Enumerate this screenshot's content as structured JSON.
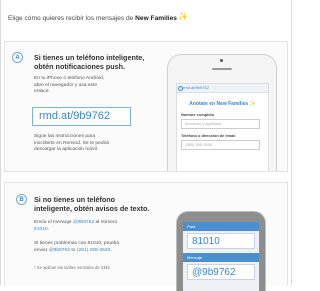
{
  "header": {
    "prefix": "Elige cómo quieres recibir los mensajes de ",
    "brand": "New Families",
    "brand_mark": "✨"
  },
  "option1": {
    "badge": "A",
    "title_line1": "Si tienes un teléfono inteligente,",
    "title_line2": "obtén notificaciones push.",
    "text_lines": [
      "En tu iPhone o teléfono Android,",
      "abre el navegador y usa este",
      "enlace:"
    ],
    "url": "rmd.at/9b9762",
    "footer_lines": [
      "Sigue las instrucciones para",
      "inscribirte en Remind. Se te pedirá",
      "descargar la aplicación móvil."
    ],
    "phone": {
      "address": "rmd.at/9b9762",
      "title": "Anótate en New Families",
      "title_mark": "✨",
      "name_label": "Nombre completo",
      "name_placeholder": "Nombres y apellidos",
      "phone_label": "Teléfono o dirección de email",
      "phone_placeholder": "(555) 555-5555"
    }
  },
  "option2": {
    "badge": "B",
    "title_line1": "Si no tienes un teléfono",
    "title_line2": "inteligente, obtén avisos de texto.",
    "text1_prefix": "Envía el mensaje ",
    "text1_code": "@9b9762",
    "text1_mid": " al número",
    "text1_number": "81010.",
    "text2_line1": "Si tienes problemas con 81010, prueba",
    "text2_prefix": "enviar ",
    "text2_code": "@9b9762",
    "text2_mid": " to ",
    "text2_number": "(281) 299-3520.",
    "footnote": "* Se aplican las tarifas normales de SMS",
    "phone": {
      "to_label": "Para",
      "to_value": "81010",
      "msg_label": "Mensaje",
      "msg_value": "@9b9762"
    }
  }
}
